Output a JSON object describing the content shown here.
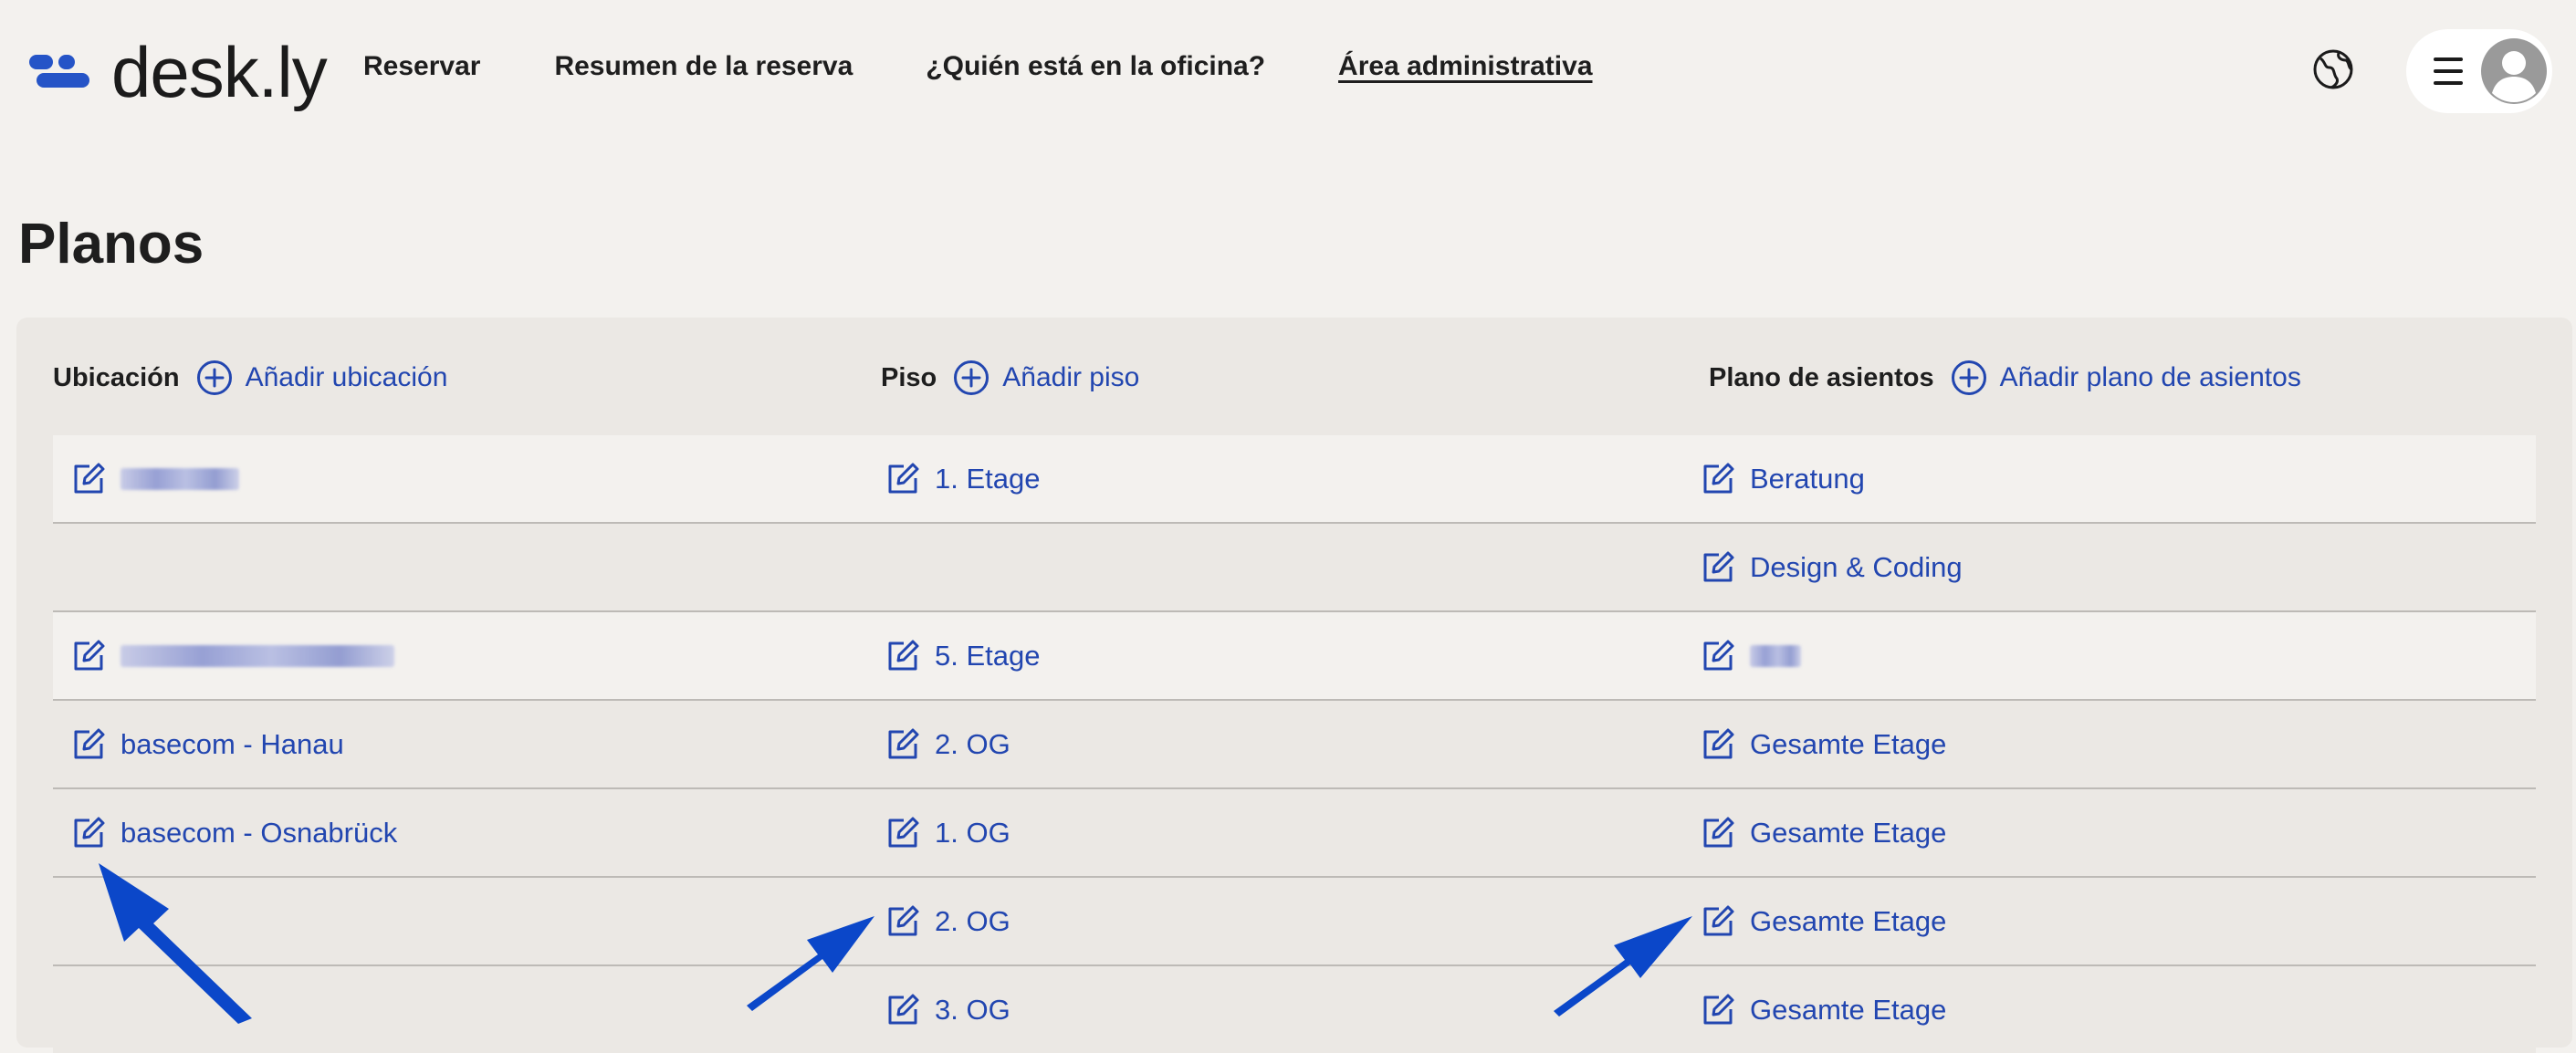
{
  "brand": {
    "logo_text": "desk.ly",
    "accent": "#2554c7",
    "link_color": "#2246b0"
  },
  "nav": {
    "items": [
      {
        "label": "Reservar",
        "active": false
      },
      {
        "label": "Resumen de la reserva",
        "active": false
      },
      {
        "label": "¿Quién está en la oficina?",
        "active": false
      },
      {
        "label": "Área administrativa",
        "active": true
      }
    ]
  },
  "header_icons": {
    "language": "globe-icon",
    "menu": "hamburger-icon",
    "user": "avatar-icon"
  },
  "page": {
    "title": "Planos"
  },
  "columns": {
    "location": {
      "label": "Ubicación",
      "add_label": "Añadir ubicación"
    },
    "floor": {
      "label": "Piso",
      "add_label": "Añadir piso"
    },
    "seating": {
      "label": "Plano de asientos",
      "add_label": "Añadir plano de asientos"
    }
  },
  "rows": [
    {
      "location": "",
      "location_redacted": true,
      "floor": "1. Etage",
      "seating": "Beratung"
    },
    {
      "location": null,
      "floor": null,
      "seating": "Design & Coding"
    },
    {
      "location": "",
      "location_redacted": true,
      "floor": "5. Etage",
      "seating": "",
      "seating_redacted": true
    },
    {
      "location": "basecom - Hanau",
      "floor": "2. OG",
      "seating": "Gesamte Etage"
    },
    {
      "location": "basecom - Osnabrück",
      "floor": "1. OG",
      "seating": "Gesamte Etage"
    },
    {
      "location": null,
      "floor": "2. OG",
      "seating": "Gesamte Etage"
    },
    {
      "location": null,
      "floor": "3. OG",
      "seating": "Gesamte Etage"
    }
  ],
  "annotations": {
    "arrow_color": "#0b47c9",
    "arrow_count": 3
  }
}
